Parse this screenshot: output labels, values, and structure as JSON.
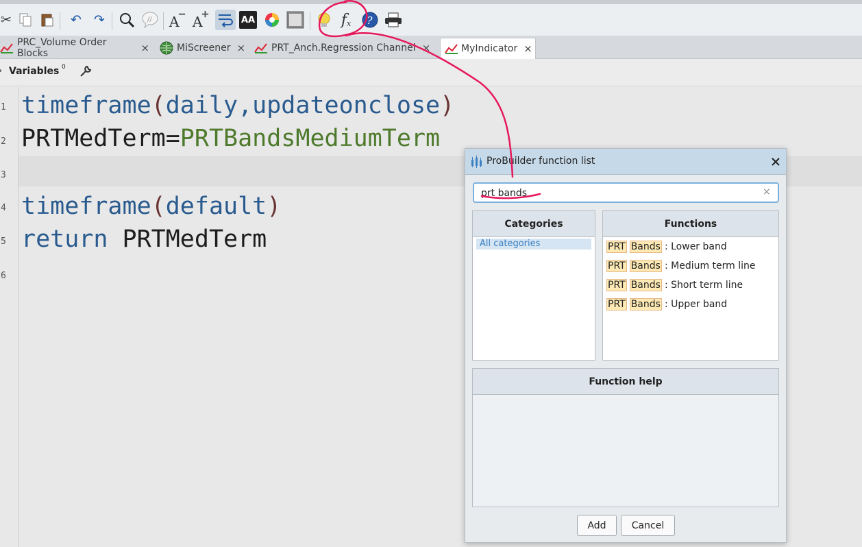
{
  "toolbar": {
    "icons": [
      "cut-icon",
      "copy-icon",
      "paste-icon",
      "undo-icon",
      "redo-icon",
      "search-icon",
      "comment-icon",
      "decrease-font-icon",
      "increase-font-icon",
      "word-wrap-icon",
      "text-style-icon",
      "color-wheel-icon",
      "frame-icon",
      "bulb-icon",
      "function-icon",
      "help-icon",
      "print-icon"
    ],
    "fx_label": "f"
  },
  "tabs": [
    {
      "label": "PRC_Volume Order Blocks",
      "close": "×"
    },
    {
      "label": "MiScreener",
      "close": "×"
    },
    {
      "label": "PRT_Anch.Regression Channel",
      "close": "×"
    },
    {
      "label": "MyIndicator",
      "close": "×",
      "active": true
    }
  ],
  "variables": {
    "label": "Variables",
    "count": "0"
  },
  "editor": {
    "line_numbers": [
      "1",
      "2",
      "3",
      "4",
      "5",
      "6"
    ],
    "lines": [
      [
        "timeframe",
        "(",
        "daily,updateonclose",
        ")"
      ],
      [
        "PRTMedTerm=",
        "PRTBandsMediumTerm"
      ],
      [],
      [
        "timeframe",
        "(",
        "default",
        ")"
      ],
      [
        "return",
        " PRTMedTerm"
      ]
    ]
  },
  "dialog": {
    "title": "ProBuilder function list",
    "search_value": "prt bands",
    "clear_icon": "×",
    "categories_header": "Categories",
    "functions_header": "Functions",
    "help_header": "Function help",
    "categories": [
      "All categories"
    ],
    "functions": [
      {
        "p1": "PRT",
        "p2": "Bands",
        "rest": ": Lower band"
      },
      {
        "p1": "PRT",
        "p2": "Bands",
        "rest": ": Medium term line"
      },
      {
        "p1": "PRT",
        "p2": "Bands",
        "rest": ": Short term line"
      },
      {
        "p1": "PRT",
        "p2": "Bands",
        "rest": ": Upper band"
      }
    ],
    "add_label": "Add",
    "cancel_label": "Cancel"
  },
  "colors": {
    "keyword": "#2a5b8f",
    "prt_constant": "#4e7a2c",
    "annotation": "#e6185a",
    "highlight": "#fde9b3"
  }
}
